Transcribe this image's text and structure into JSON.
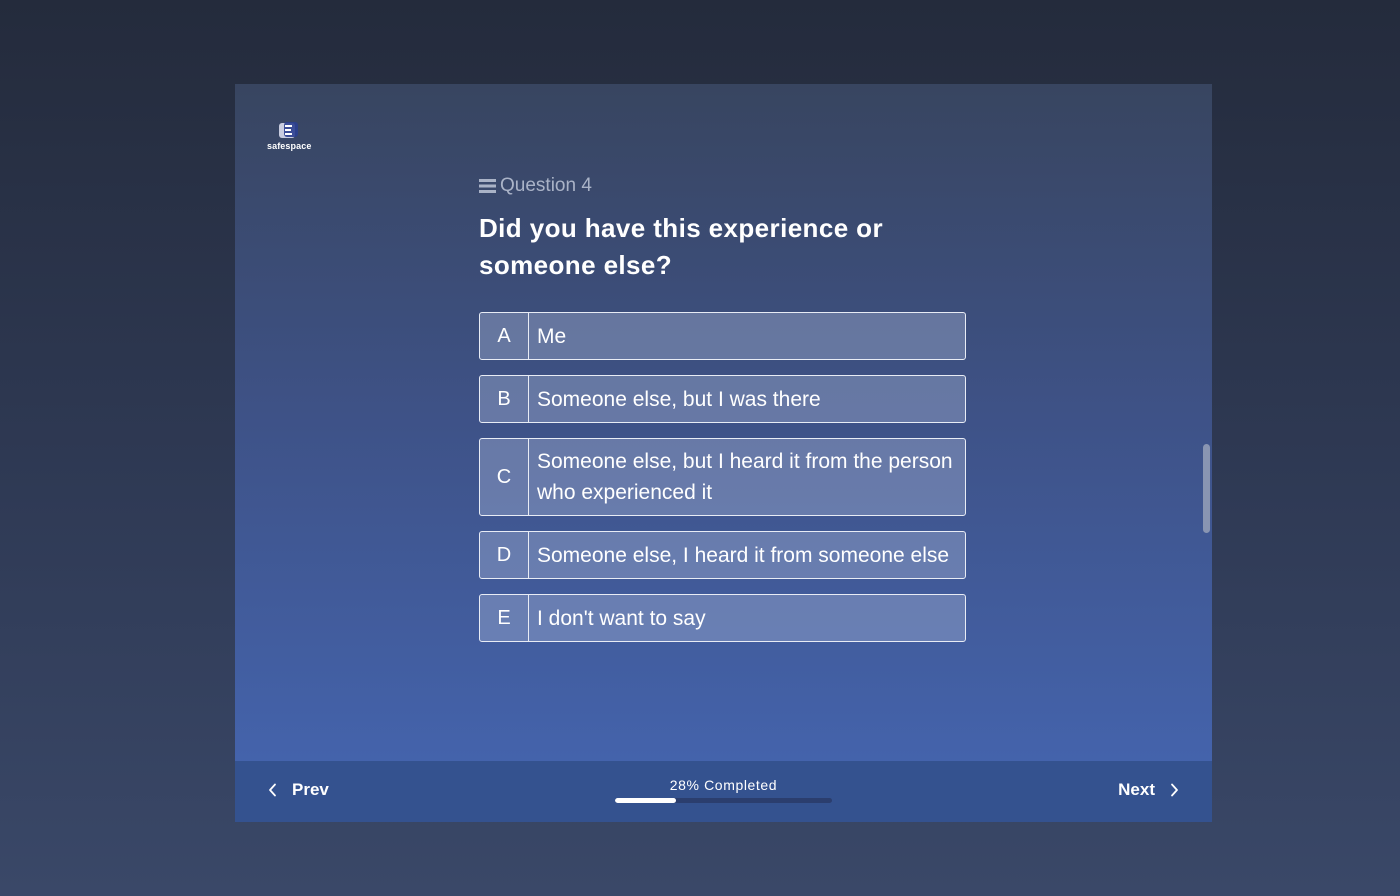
{
  "brand": {
    "name": "safespace",
    "logo_icon": "safespace-logo-icon"
  },
  "question": {
    "number_label": "Question 4",
    "menu_icon": "menu-icon",
    "title": "Did you have this experience or someone else?"
  },
  "options": [
    {
      "key": "A",
      "label": "Me"
    },
    {
      "key": "B",
      "label": "Someone else, but I was there"
    },
    {
      "key": "C",
      "label": "Someone else, but I heard it from the person who experienced it"
    },
    {
      "key": "D",
      "label": "Someone else, I heard it from someone else"
    },
    {
      "key": "E",
      "label": "I don't want to say"
    }
  ],
  "footer": {
    "prev_label": "Prev",
    "next_label": "Next",
    "progress_text": "28% Completed",
    "progress_fraction": 0.28
  },
  "colors": {
    "accent": "#ffffff",
    "footer_bg": "#34528f",
    "frame_bottom": "#4566b2"
  }
}
